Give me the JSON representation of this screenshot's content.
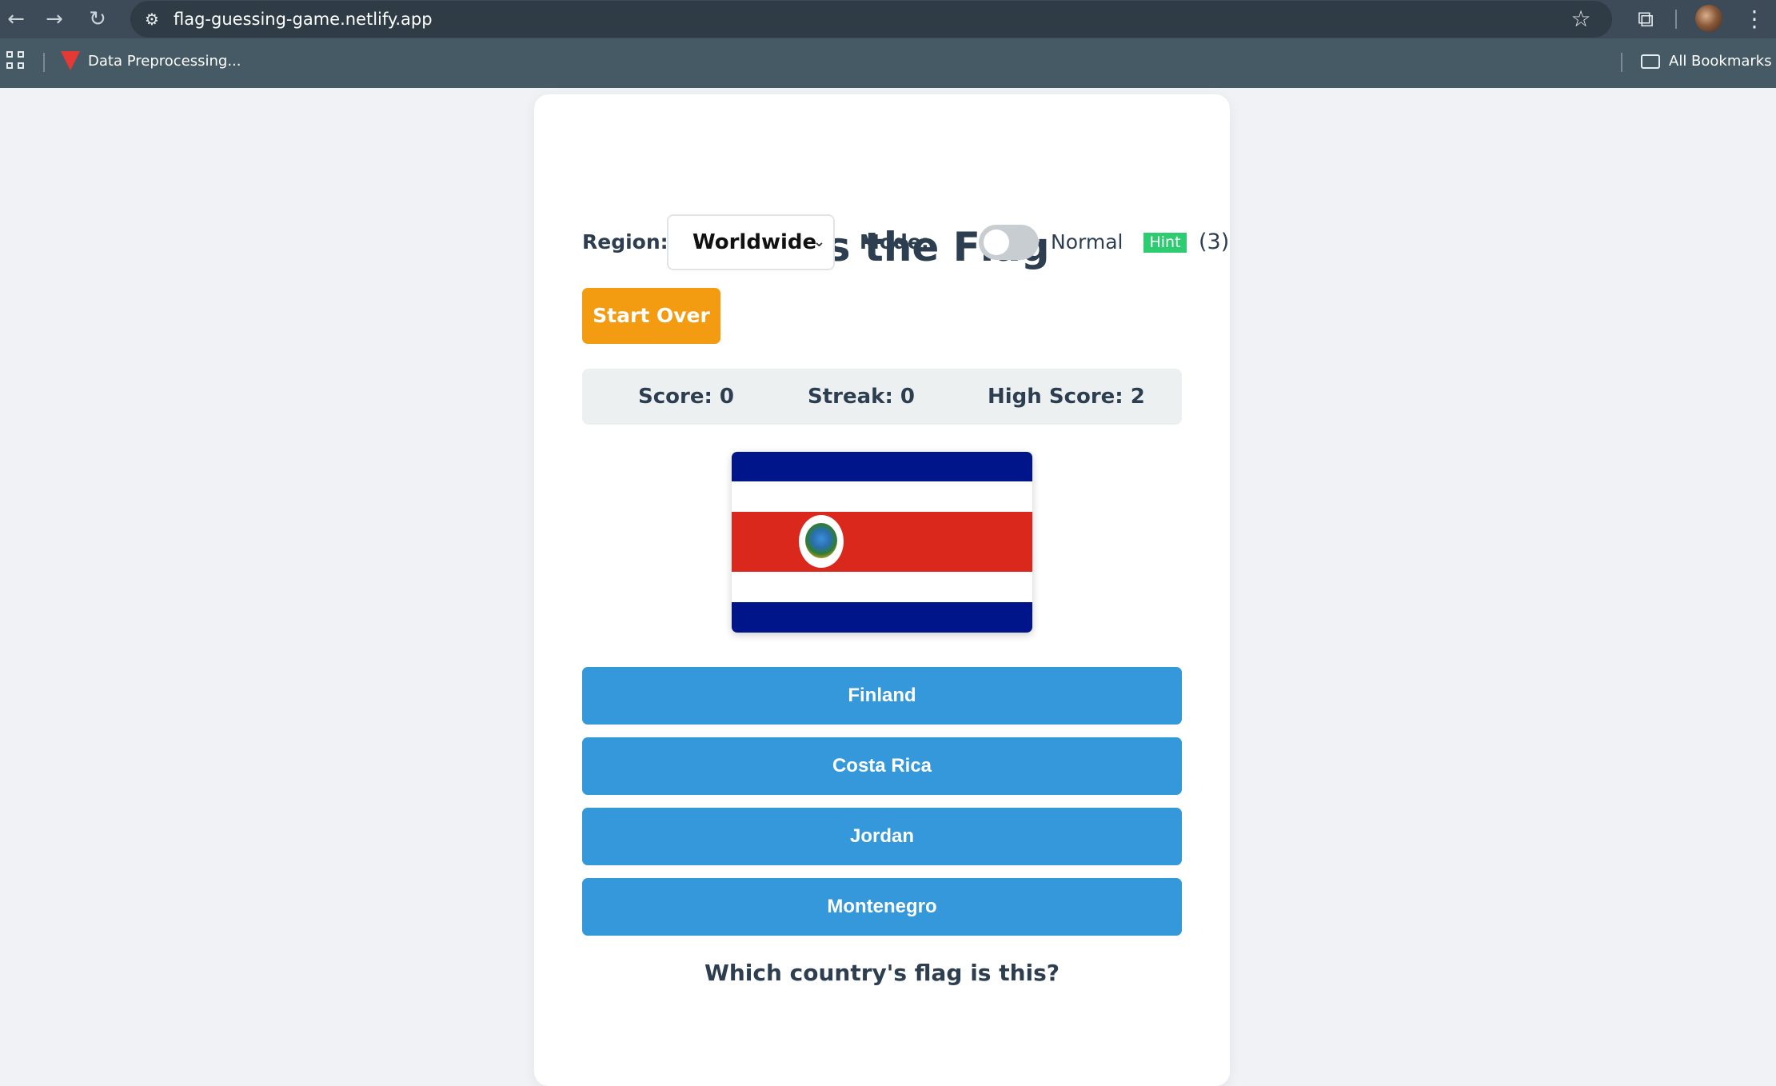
{
  "browser": {
    "url": "flag-guessing-game.netlify.app",
    "bookmarks": [
      {
        "label": "Data Preprocessing..."
      }
    ],
    "all_bookmarks_label": "All Bookmarks"
  },
  "game": {
    "title": "Guess the Flag",
    "region": {
      "label": "Region:",
      "selected": "Worldwide"
    },
    "mode": {
      "label": "Mode:",
      "value": "Normal",
      "enabled": false
    },
    "hint": {
      "label": "Hint",
      "count": "(3)"
    },
    "start_over_label": "Start Over",
    "stats": {
      "score": "Score: 0",
      "streak": "Streak: 0",
      "high_score": "High Score: 2"
    },
    "flag": {
      "stripes": [
        "#00158a",
        "#ffffff",
        "#da291c",
        "#ffffff",
        "#00158a"
      ]
    },
    "answers": [
      "Finland",
      "Costa Rica",
      "Jordan",
      "Montenegro"
    ],
    "question": "Which country's flag is this?"
  },
  "colors": {
    "accent_orange": "#f39c12",
    "accent_blue": "#3498db",
    "hint_green": "#2ecc71",
    "title_text": "#2c3e50"
  }
}
